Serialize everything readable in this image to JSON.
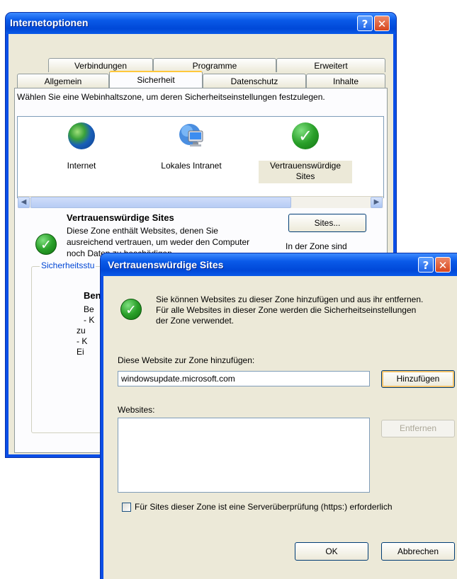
{
  "internet_options": {
    "title": "Internetoptionen",
    "tabs_row1": [
      "Verbindungen",
      "Programme",
      "Erweitert"
    ],
    "tabs_row2": [
      "Allgemein",
      "Sicherheit",
      "Datenschutz",
      "Inhalte"
    ],
    "selected_tab": "Sicherheit",
    "instruction": "Wählen Sie eine Webinhaltszone, um deren Sicherheitseinstellungen festzulegen.",
    "zones": [
      {
        "label": "Internet",
        "icon": "globe-icon"
      },
      {
        "label": "Lokales Intranet",
        "icon": "network-computer-icon"
      },
      {
        "label": "Vertrauenswürdige Sites",
        "icon": "check-icon"
      }
    ],
    "zone_title": "Vertrauenswürdige Sites",
    "zone_description": "Diese Zone enthält Websites, denen Sie ausreichend vertrauen, um weder den Computer noch Daten zu beschädigen.",
    "sites_button": "Sites...",
    "zone_sites_note": "In der Zone sind keine Sites.",
    "security_level_group": "Sicherheitsstu",
    "level_bold": "Benu",
    "level_lines": [
      "Be",
      "- K",
      "zu",
      "- K",
      "Ei"
    ]
  },
  "trusted_sites": {
    "title": "Vertrauenswürdige Sites",
    "info": "Sie können Websites zu dieser Zone hinzufügen und aus ihr entfernen. Für alle Websites in dieser Zone werden die Sicherheitseinstellungen der Zone verwendet.",
    "add_label": "Diese Website zur Zone hinzufügen:",
    "add_value": "windowsupdate.microsoft.com",
    "add_button": "Hinzufügen",
    "websites_label": "Websites:",
    "remove_button": "Entfernen",
    "https_checkbox": "Für Sites dieser Zone ist eine Serverüberprüfung (https:) erforderlich",
    "https_checked": false,
    "ok_button": "OK",
    "cancel_button": "Abbrechen"
  },
  "titlebar_buttons": {
    "help": "?",
    "close": "✕"
  },
  "colors": {
    "titlebar": "#0a5ae8",
    "dialog_bg": "#ece9d8",
    "tab_highlight": "#ffc83c"
  }
}
